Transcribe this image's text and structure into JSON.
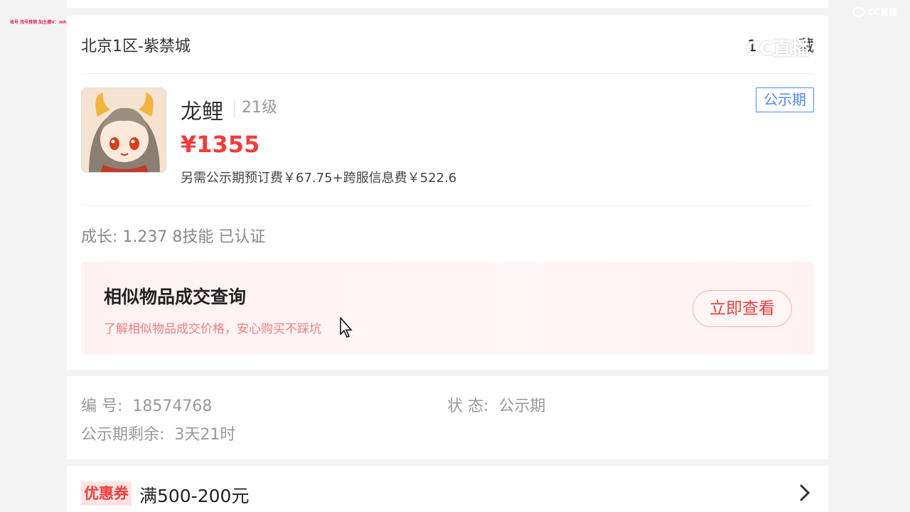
{
  "overlay": {
    "watermark": "收号 找号推销 加主播V：mh1122369",
    "cc_logo_small": "CC直播",
    "cc_logo_large": "CC直播"
  },
  "listing": {
    "server": "北京1区-紫禁城",
    "favorite_prefix": "1",
    "favorite_suffix": "藏",
    "pet_name": "龙鲤",
    "level": "21级",
    "price": "¥1355",
    "fee_note": "另需公示期预订费￥67.75+跨服信息费￥522.6",
    "status_tag": "公示期",
    "growth": "成长: 1.237 8技能 已认证"
  },
  "similar": {
    "title": "相似物品成交查询",
    "subtitle": "了解相似物品成交价格，安心购买不踩坑",
    "button": "立即查看"
  },
  "info": {
    "id_label": "编 号:",
    "id_value": "18574768",
    "status_label": "状 态:",
    "status_value": "公示期",
    "remaining_label": "公示期剩余:",
    "remaining_value": "3天21时"
  },
  "coupon": {
    "tag": "优惠券",
    "text": "满500-200元"
  },
  "colors": {
    "price_red": "#f23c3c",
    "tag_blue": "#4a8ee8",
    "watermark_pink": "#e0245e"
  },
  "icons": [
    "cursor-icon",
    "chevron-right-icon",
    "cc-logo-icon"
  ]
}
